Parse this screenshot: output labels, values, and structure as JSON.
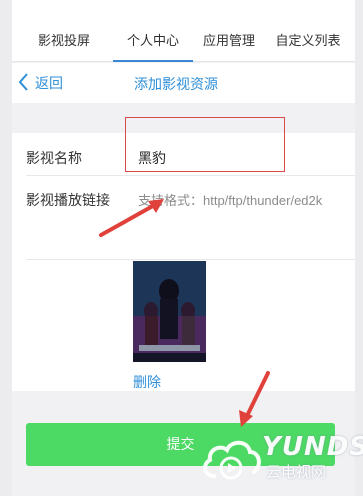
{
  "tabs": [
    {
      "label": "影视投屏"
    },
    {
      "label": "个人中心"
    },
    {
      "label": "应用管理"
    },
    {
      "label": "自定义列表"
    }
  ],
  "navbar": {
    "back_label": "返回",
    "title": "添加影视资源"
  },
  "form": {
    "name_label": "影视名称",
    "name_value": "黑豹",
    "link_label": "影视播放链接",
    "link_placeholder": "支持格式：http/ftp/thunder/ed2k"
  },
  "poster": {
    "delete_label": "删除"
  },
  "submit": {
    "label": "提交"
  },
  "watermark": {
    "title": "YUNDS",
    "subtitle": "云电视网"
  },
  "colors": {
    "accent": "#2f8fd8",
    "submit": "#4cd964",
    "highlight": "#d84b4b",
    "arrow": "#e0413a"
  }
}
